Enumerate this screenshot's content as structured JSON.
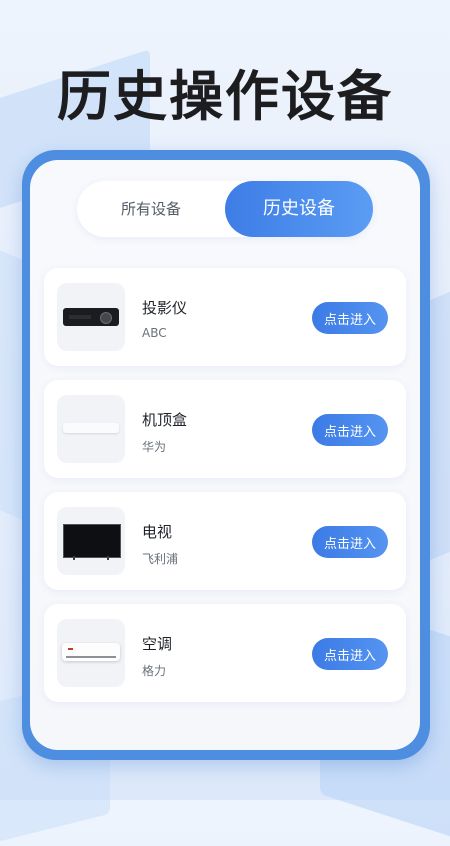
{
  "headline": "历史操作设备",
  "tabs": [
    {
      "label": "所有设备",
      "active": false
    },
    {
      "label": "历史设备",
      "active": true
    }
  ],
  "devices": [
    {
      "name": "投影仪",
      "brand": "ABC",
      "button": "点击进入",
      "icon": "projector-icon"
    },
    {
      "name": "机顶盒",
      "brand": "华为",
      "button": "点击进入",
      "icon": "set-top-box-icon"
    },
    {
      "name": "电视",
      "brand": "飞利浦",
      "button": "点击进入",
      "icon": "tv-icon"
    },
    {
      "name": "空调",
      "brand": "格力",
      "button": "点击进入",
      "icon": "air-conditioner-icon"
    }
  ],
  "colors": {
    "accent": "#3d7de6",
    "frame": "#4d8ee0",
    "title": "#1d1d1f"
  }
}
